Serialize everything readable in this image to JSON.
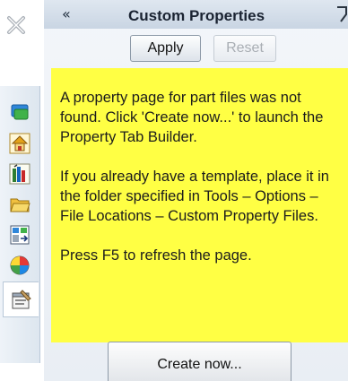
{
  "panel": {
    "collapse_glyph": "«",
    "title": "Custom Properties"
  },
  "toolbar": {
    "apply_label": "Apply",
    "reset_label": "Reset"
  },
  "message": {
    "p1": "A property page for part files was not found. Click 'Create now...' to launch the Property Tab Builder.",
    "p2": "If you already have a template, place it in the folder specified in Tools – Options – File Locations – Custom Property Files.",
    "p3": "Press F5 to refresh the page."
  },
  "actions": {
    "create_label": "Create now..."
  },
  "side_tabs": [
    {
      "icon": "feature-manager-icon"
    },
    {
      "icon": "home-icon"
    },
    {
      "icon": "design-library-icon"
    },
    {
      "icon": "file-explorer-icon"
    },
    {
      "icon": "view-palette-icon"
    },
    {
      "icon": "appearances-icon"
    },
    {
      "icon": "custom-properties-icon",
      "active": true
    }
  ],
  "colors": {
    "message_background": "#ffff44",
    "panel_background": "#eef2f7",
    "header_background": "#d4dee9"
  }
}
